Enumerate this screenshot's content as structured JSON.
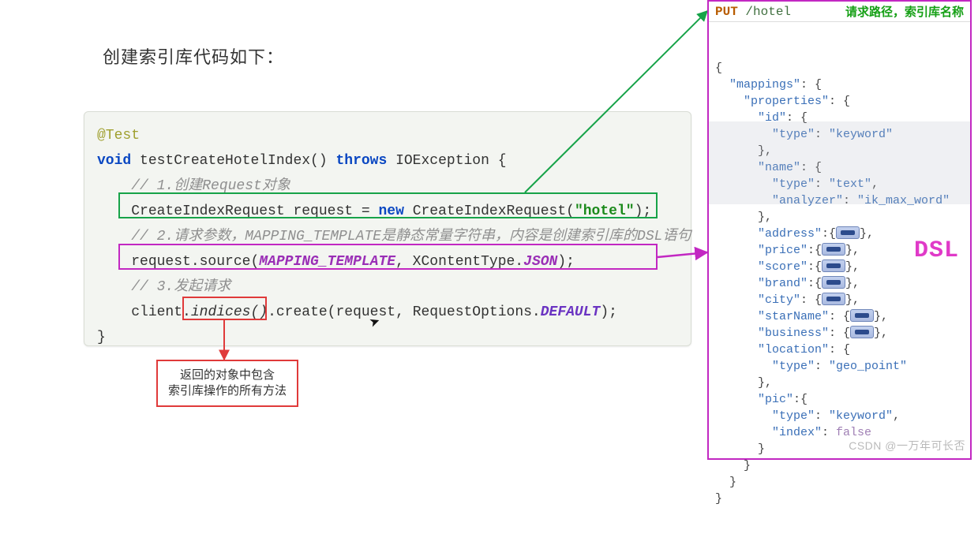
{
  "title": "创建索引库代码如下：",
  "code": {
    "annotation": "@Test",
    "kw_void": "void",
    "method_sig_a": " testCreateHotelIndex() ",
    "kw_throws": "throws",
    "method_sig_b": " IOException {",
    "c1": "// 1.创建Request对象",
    "l1a": "CreateIndexRequest request = ",
    "kw_new": "new",
    "l1b": " CreateIndexRequest(",
    "str_hotel": "\"hotel\"",
    "l1c": ");",
    "c2": "// 2.请求参数，MAPPING_TEMPLATE是静态常量字符串，内容是创建索引库的DSL语句",
    "l2a": "request.source(",
    "const_mt": "MAPPING_TEMPLATE",
    "l2b": ", XContentType.",
    "const_json": "JSON",
    "l2c": ");",
    "c3": "// 3.发起请求",
    "l3a": "client.",
    "l3box": "indices()",
    "l3b": ".create(request, RequestOptions.",
    "const_def": "DEFAULT",
    "l3c": ");",
    "close": "}"
  },
  "callout": "返回的对象中包含\n索引库操作的所有方法",
  "dsl": {
    "method": "PUT",
    "path": "/hotel",
    "note": "请求路径，索引库名称",
    "label": "DSL",
    "lines": {
      "open": "{",
      "mappings": "\"mappings\"",
      "properties": "\"properties\"",
      "id": "\"id\"",
      "type": "\"type\"",
      "kw_keyword": "\"keyword\"",
      "name": "\"name\"",
      "kw_text": "\"text\"",
      "analyzer": "\"analyzer\"",
      "kw_ik": "\"ik_max_word\"",
      "address": "\"address\"",
      "price": "\"price\"",
      "score": "\"score\"",
      "brand": "\"brand\"",
      "city": "\"city\"",
      "starName": "\"starName\"",
      "business": "\"business\"",
      "location": "\"location\"",
      "kw_geo": "\"geo_point\"",
      "pic": "\"pic\"",
      "index": "\"index\"",
      "false": "false"
    }
  },
  "watermark": "CSDN @一万年可长否"
}
